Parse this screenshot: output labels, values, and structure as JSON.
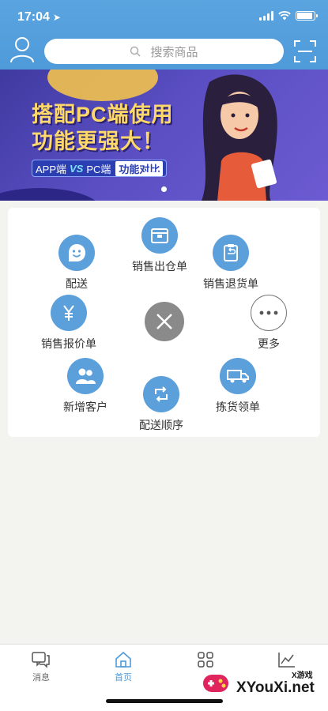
{
  "status_bar": {
    "time": "17:04",
    "battery_level": 0.9
  },
  "header": {
    "search_placeholder": "搜索商品"
  },
  "banner": {
    "headline_line1": "搭配PC端使用",
    "headline_line2": "功能更强大！",
    "pill_left": "APP端",
    "pill_vs": "VS",
    "pill_mid": "PC端",
    "pill_right": "功能对比",
    "slide_count": 1,
    "active_slide": 1
  },
  "menu": {
    "items": [
      {
        "label": "配送",
        "icon": "smile-icon"
      },
      {
        "label": "销售出仓单",
        "icon": "box-icon"
      },
      {
        "label": "销售退货单",
        "icon": "return-clipboard-icon"
      },
      {
        "label": "销售报价单",
        "icon": "yen-icon"
      },
      {
        "label": "更多",
        "icon": "more-dots-icon"
      },
      {
        "label": "新增客户",
        "icon": "users-icon"
      },
      {
        "label": "配送顺序",
        "icon": "refresh-order-icon"
      },
      {
        "label": "拣货领单",
        "icon": "truck-icon"
      }
    ],
    "close_icon": "close-icon"
  },
  "tabbar": {
    "tabs": [
      {
        "label": "消息",
        "icon": "message-icon",
        "active": false
      },
      {
        "label": "首页",
        "icon": "home-icon",
        "active": true
      },
      {
        "label": "",
        "icon": "apps-grid-icon",
        "active": false
      },
      {
        "label": "",
        "icon": "chart-icon",
        "active": false
      }
    ]
  },
  "watermark": {
    "text": "XYouXi.net",
    "small": "X游戏"
  },
  "colors": {
    "header_blue": "#4f9ad9",
    "icon_blue": "#5b9fdb",
    "close_gray": "#8a8a8a"
  }
}
